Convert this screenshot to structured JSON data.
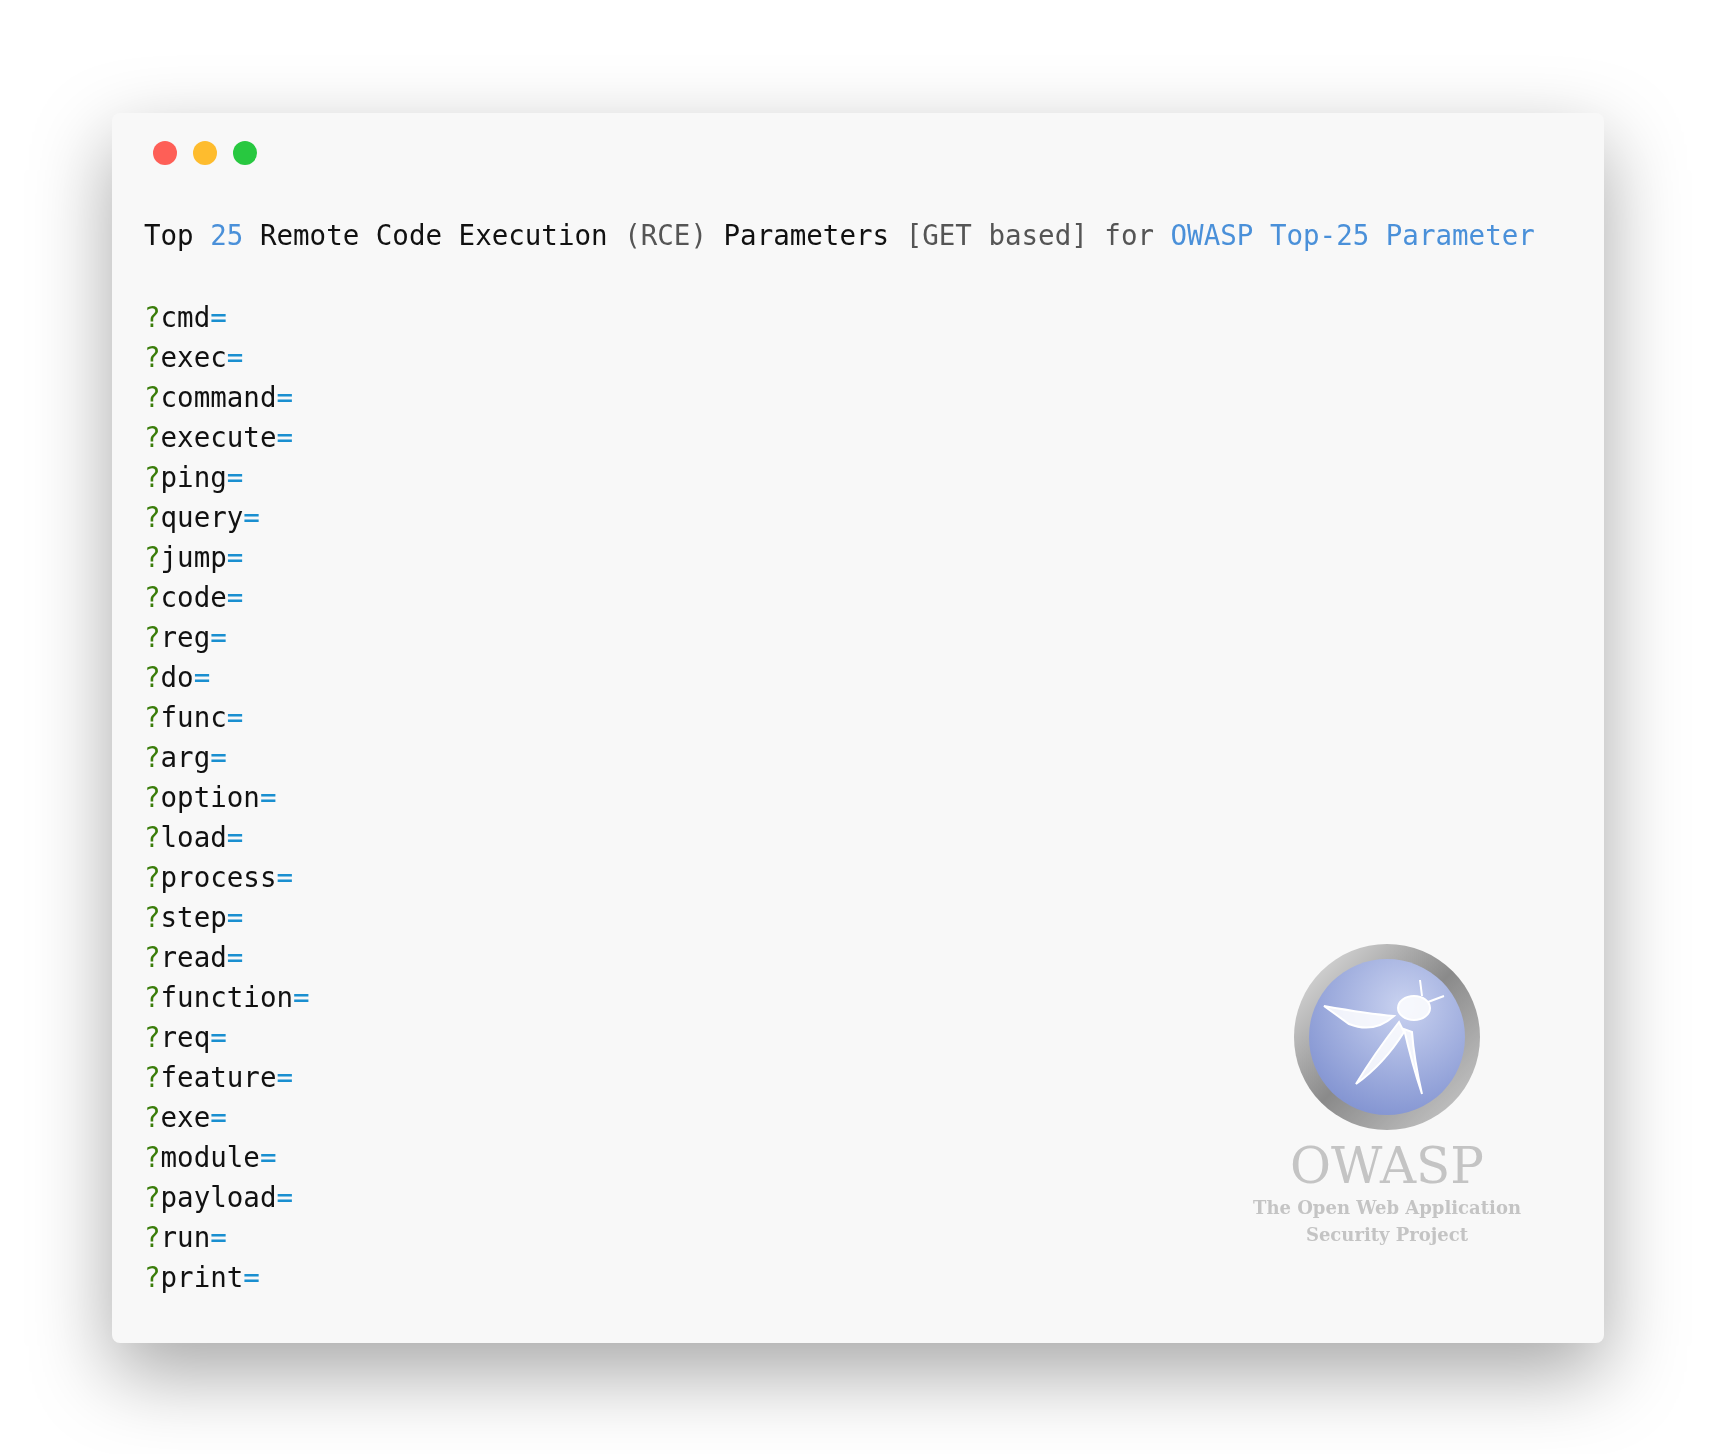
{
  "window": {
    "controls": [
      {
        "kind": "close"
      },
      {
        "kind": "minimize"
      },
      {
        "kind": "zoom"
      }
    ]
  },
  "title_line": [
    {
      "text": "Top ",
      "kind": "plain"
    },
    {
      "text": "25",
      "kind": "number"
    },
    {
      "text": " Remote Code Execution ",
      "kind": "plain"
    },
    {
      "text": "(RCE)",
      "kind": "muted"
    },
    {
      "text": " Parameters ",
      "kind": "plain"
    },
    {
      "text": "[GET based] for ",
      "kind": "muted"
    },
    {
      "text": "OWASP Top-25 Parameter",
      "kind": "link"
    }
  ],
  "lines": [
    {
      "prefix": "?",
      "name": "cmd",
      "suffix": "="
    },
    {
      "prefix": "?",
      "name": "exec",
      "suffix": "="
    },
    {
      "prefix": "?",
      "name": "command",
      "suffix": "="
    },
    {
      "prefix": "?",
      "name": "execute",
      "suffix": "="
    },
    {
      "prefix": "?",
      "name": "ping",
      "suffix": "="
    },
    {
      "prefix": "?",
      "name": "query",
      "suffix": "="
    },
    {
      "prefix": "?",
      "name": "jump",
      "suffix": "="
    },
    {
      "prefix": "?",
      "name": "code",
      "suffix": "="
    },
    {
      "prefix": "?",
      "name": "reg",
      "suffix": "="
    },
    {
      "prefix": "?",
      "name": "do",
      "suffix": "="
    },
    {
      "prefix": "?",
      "name": "func",
      "suffix": "="
    },
    {
      "prefix": "?",
      "name": "arg",
      "suffix": "="
    },
    {
      "prefix": "?",
      "name": "option",
      "suffix": "="
    },
    {
      "prefix": "?",
      "name": "load",
      "suffix": "="
    },
    {
      "prefix": "?",
      "name": "process",
      "suffix": "="
    },
    {
      "prefix": "?",
      "name": "step",
      "suffix": "="
    },
    {
      "prefix": "?",
      "name": "read",
      "suffix": "="
    },
    {
      "prefix": "?",
      "name": "function",
      "suffix": "="
    },
    {
      "prefix": "?",
      "name": "req",
      "suffix": "="
    },
    {
      "prefix": "?",
      "name": "feature",
      "suffix": "="
    },
    {
      "prefix": "?",
      "name": "exe",
      "suffix": "="
    },
    {
      "prefix": "?",
      "name": "module",
      "suffix": "="
    },
    {
      "prefix": "?",
      "name": "payload",
      "suffix": "="
    },
    {
      "prefix": "?",
      "name": "run",
      "suffix": "="
    },
    {
      "prefix": "?",
      "name": "print",
      "suffix": "="
    }
  ],
  "logo": {
    "wordmark": "OWASP",
    "tagline": [
      "The Open Web Application",
      "Security Project"
    ]
  }
}
